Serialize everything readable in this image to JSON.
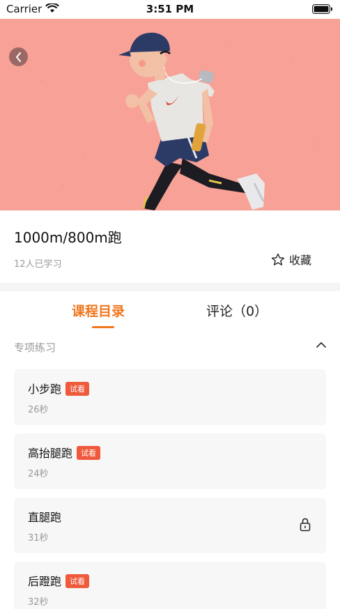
{
  "status_bar": {
    "carrier": "Carrier",
    "time": "3:51 PM"
  },
  "course": {
    "title": "1000m/800m跑",
    "learners": "12人已学习",
    "favorite_label": "收藏"
  },
  "tabs": [
    {
      "label": "课程目录",
      "active": true
    },
    {
      "label": "评论（0）",
      "active": false
    }
  ],
  "section": {
    "title": "专项练习"
  },
  "lessons": [
    {
      "name": "小步跑",
      "badge": "试看",
      "duration": "26秒",
      "locked": false
    },
    {
      "name": "高抬腿跑",
      "badge": "试看",
      "duration": "24秒",
      "locked": false
    },
    {
      "name": "直腿跑",
      "badge": "",
      "duration": "31秒",
      "locked": true
    },
    {
      "name": "后蹬跑",
      "badge": "试看",
      "duration": "32秒",
      "locked": false
    }
  ],
  "colors": {
    "accent": "#f0771e",
    "badge": "#ef5a3c",
    "hero_bg": "#f7a197"
  },
  "icons": [
    "wifi-icon",
    "battery-icon",
    "back-arrow-icon",
    "star-outline-icon",
    "chevron-up-icon",
    "lock-icon"
  ]
}
